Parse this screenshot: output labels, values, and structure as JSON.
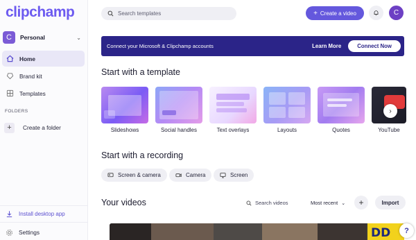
{
  "app": {
    "logo": "clipchamp"
  },
  "sidebar": {
    "workspace": {
      "initial": "C",
      "name": "Personal"
    },
    "items": [
      {
        "label": "Home",
        "icon": "home-icon",
        "active": true
      },
      {
        "label": "Brand kit",
        "icon": "brand-kit-icon",
        "active": false
      },
      {
        "label": "Templates",
        "icon": "templates-icon",
        "active": false
      }
    ],
    "folders_label": "FOLDERS",
    "create_folder": "Create a folder",
    "install": "Install desktop app",
    "settings": "Settings"
  },
  "topbar": {
    "search_placeholder": "Search templates",
    "create_label": "Create a video",
    "user_initial": "C"
  },
  "banner": {
    "text": "Connect your Microsoft & Clipchamp accounts",
    "learn_more": "Learn More",
    "connect": "Connect Now"
  },
  "templates": {
    "title": "Start with a template",
    "items": [
      {
        "label": "Slideshows"
      },
      {
        "label": "Social handles"
      },
      {
        "label": "Text overlays"
      },
      {
        "label": "Layouts"
      },
      {
        "label": "Quotes"
      },
      {
        "label": "YouTube"
      }
    ]
  },
  "recording": {
    "title": "Start with a recording",
    "options": [
      {
        "label": "Screen & camera",
        "icon": "screen-camera-icon"
      },
      {
        "label": "Camera",
        "icon": "camera-icon"
      },
      {
        "label": "Screen",
        "icon": "monitor-icon"
      }
    ]
  },
  "videos": {
    "title": "Your videos",
    "search_label": "Search videos",
    "sort_label": "Most recent",
    "import_label": "Import"
  },
  "help": {
    "label": "?"
  },
  "colors": {
    "accent": "#6458dd",
    "banner": "#2b2488",
    "active_nav": "#e9e7f7"
  }
}
